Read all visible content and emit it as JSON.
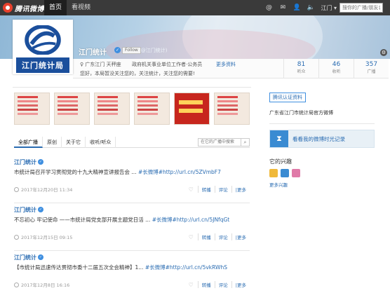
{
  "topnav": {
    "logo_text": "腾讯微博",
    "home_label": "首页",
    "videos_label": "看视频",
    "region_label": "江门 ▾",
    "search_placeholder": "搜你的广播/朋友名称"
  },
  "profile": {
    "name": "江门统计",
    "follow_label": "Follow",
    "handle": "(@江门统计)",
    "avatar_text": "江门统计局",
    "location": "♀ 广东江门 天秤座",
    "category": "政府机关事业单位工作者·公务员",
    "more_label": "更多资料",
    "bio": "您好，本局暂没关注您的，关注统计，关注您的需要!",
    "stats": [
      {
        "num": "81",
        "label": "听众"
      },
      {
        "num": "46",
        "label": "收听"
      },
      {
        "num": "357",
        "label": "广播"
      }
    ]
  },
  "tabs": {
    "items": [
      "全部广播",
      "原创",
      "关于它",
      "收听/听众"
    ],
    "search_placeholder": "在它的广播中搜索"
  },
  "posts": [
    {
      "author": "江门统计",
      "text": "市统计局召开学习贯彻党的十九大精神宣讲报告会 ...",
      "tag": "#长微博#http://url.cn/5ZVmbF7",
      "time": "2017年12月20日 11:34",
      "actions": [
        "转播",
        "评论",
        "|更多"
      ]
    },
    {
      "author": "江门统计",
      "text": "不忘初心 牢记使命 ——市统计局党支部开展主题党日活 ...",
      "tag": "#长微博#http://url.cn/5JNfqGt",
      "time": "2017年12月15日 09:15",
      "actions": [
        "转播",
        "评论",
        "|更多"
      ]
    },
    {
      "author": "江门统计",
      "text": "【市统计局迅速传达贯彻市委十二届五次全会精神】1...",
      "tag": "#长微博#http://url.cn/5vkRWhS",
      "time": "2017年12月8日 16:16",
      "actions": [
        "转播",
        "评论",
        "|更多"
      ]
    }
  ],
  "sidebar": {
    "auth_label": "腾讯认证资料",
    "auth_desc": "广东省江门市统计局官方微博",
    "timeline_text": "看看我的微博时光记录",
    "interests_title": "它的兴趣",
    "more_label": "更多兴趣"
  },
  "colors": {
    "accent": "#2a6cb2",
    "nav_bg": "#3a3a3a",
    "avatar_bar": "#1b4f9c"
  }
}
